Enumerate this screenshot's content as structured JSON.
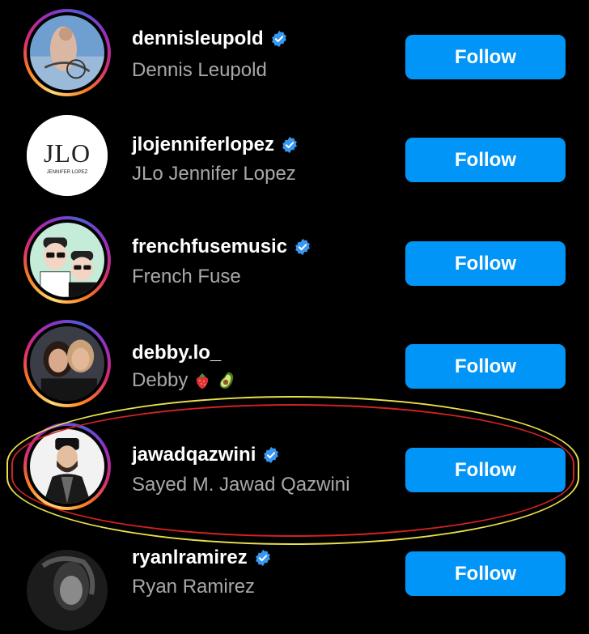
{
  "accounts": [
    {
      "username": "dennisleupold",
      "full_name": "Dennis Leupold",
      "verified": true,
      "follow_label": "Follow"
    },
    {
      "username": "jlojenniferlopez",
      "full_name": "JLo Jennifer Lopez",
      "verified": true,
      "follow_label": "Follow",
      "logo_text": "JLO",
      "logo_subtext": "JENNIFER LOPEZ"
    },
    {
      "username": "frenchfusemusic",
      "full_name": "French Fuse",
      "verified": true,
      "follow_label": "Follow"
    },
    {
      "username": "debby.lo_",
      "full_name": "Debby",
      "verified": false,
      "follow_label": "Follow",
      "emojis": [
        "strawberry",
        "avocado"
      ]
    },
    {
      "username": "jawadqazwini",
      "full_name": "Sayed M. Jawad Qazwini",
      "verified": true,
      "follow_label": "Follow"
    },
    {
      "username": "ryanlramirez",
      "full_name": "Ryan Ramirez",
      "verified": true,
      "follow_label": "Follow"
    }
  ],
  "colors": {
    "background": "#000000",
    "follow_button": "#0095f6",
    "verified_badge": "#3897f0",
    "secondary_text": "#a8a8a8",
    "highlight_outer": "#e8e14a",
    "highlight_inner": "#d32222"
  }
}
